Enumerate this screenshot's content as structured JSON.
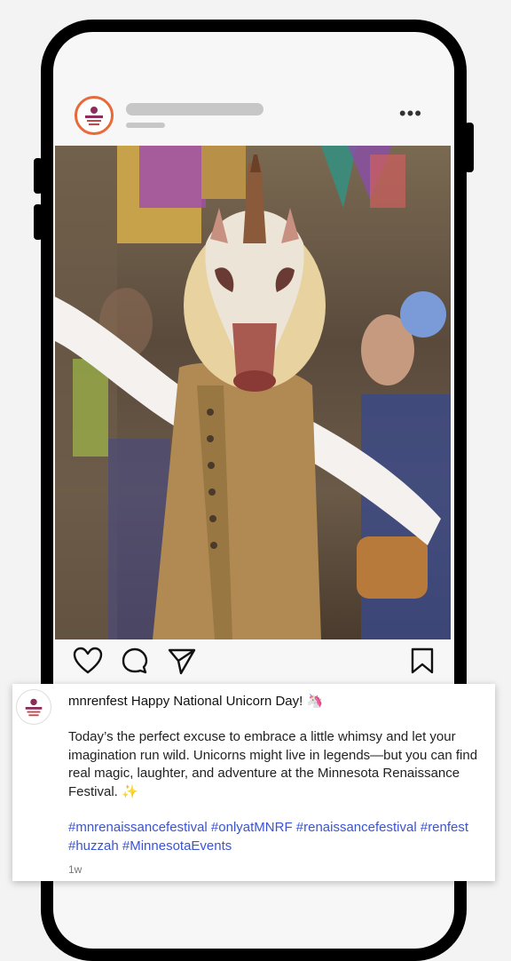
{
  "post": {
    "more_icon": "•••",
    "image_alt": "Performer in a unicorn mask and renaissance costume at a festival"
  },
  "caption": {
    "username": "mnrenfest",
    "headline": "Happy National Unicorn Day! 🦄",
    "body": "Today’s the perfect excuse to embrace a little whimsy and let your imagination run wild. Unicorns might live in legends—but you can find real magic, laughter, and adventure at the Minnesota Renaissance Festival. ✨",
    "hashtags": "#mnrenaissancefestival #onlyatMNRF #renaissancefestival #renfest #huzzah #MinnesotaEvents",
    "time": "1w"
  },
  "icons": [
    "heart-icon",
    "comment-icon",
    "share-icon",
    "bookmark-icon"
  ],
  "colors": {
    "hashtag": "#3b54d4",
    "avatar_ring": "#e8693a"
  }
}
